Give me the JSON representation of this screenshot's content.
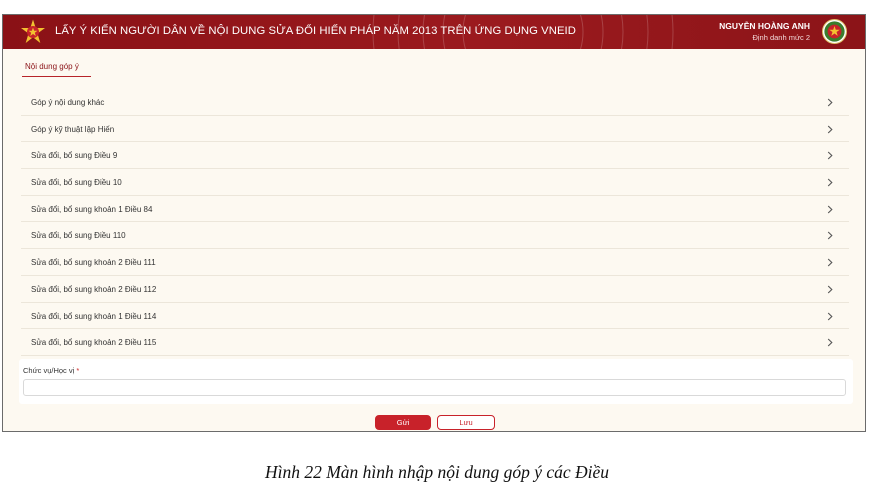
{
  "header": {
    "title": "LẤY Ý KIẾN NGƯỜI DÂN VỀ NỘI DUNG SỬA ĐỔI HIẾN PHÁP NĂM 2013 TRÊN ỨNG DỤNG VNEID",
    "user_name": "NGUYỄN HOÀNG ANH",
    "user_level": "Định danh mức 2",
    "colors": {
      "bar": "#8a1116",
      "accent": "#c8222a",
      "emblem_gold": "#f2c230"
    }
  },
  "tab": {
    "label": "Nội dung góp ý"
  },
  "items": [
    {
      "label": "Góp ý nội dung khác",
      "icon": "chevron-right-icon"
    },
    {
      "label": "Góp ý kỹ thuật lập Hiến",
      "icon": "chevron-right-icon"
    },
    {
      "label": "Sửa đổi, bổ sung Điều 9",
      "icon": "chevron-right-icon"
    },
    {
      "label": "Sửa đổi, bổ sung Điều 10",
      "icon": "chevron-right-icon"
    },
    {
      "label": "Sửa đổi, bổ sung khoản 1 Điều 84",
      "icon": "chevron-right-icon"
    },
    {
      "label": "Sửa đổi, bổ sung Điều 110",
      "icon": "chevron-right-icon"
    },
    {
      "label": "Sửa đổi, bổ sung khoản 2 Điều 111",
      "icon": "chevron-right-icon"
    },
    {
      "label": "Sửa đổi, bổ sung khoản 2 Điều 112",
      "icon": "chevron-right-icon"
    },
    {
      "label": "Sửa đổi, bổ sung khoản 1 Điều 114",
      "icon": "chevron-right-icon"
    },
    {
      "label": "Sửa đổi, bổ sung khoản 2 Điều 115",
      "icon": "chevron-right-icon"
    }
  ],
  "field": {
    "label": "Chức vụ/Học vị",
    "required_mark": "*",
    "value": "",
    "placeholder": ""
  },
  "buttons": {
    "submit": "Gửi",
    "save": "Lưu"
  },
  "caption": "Hình 22 Màn hình nhập nội dung góp ý các Điều"
}
